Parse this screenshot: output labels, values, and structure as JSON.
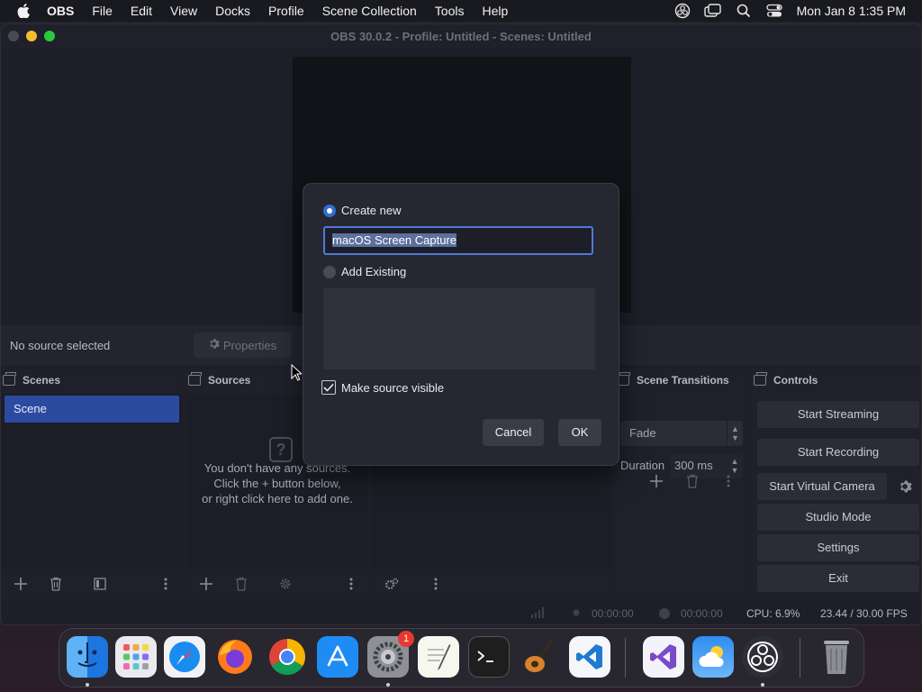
{
  "menubar": {
    "app_name": "OBS",
    "items": [
      "File",
      "Edit",
      "View",
      "Docks",
      "Profile",
      "Scene Collection",
      "Tools",
      "Help"
    ],
    "clock": "Mon Jan 8  1:35 PM"
  },
  "window": {
    "title": "OBS 30.0.2 - Profile: Untitled - Scenes: Untitled"
  },
  "context_bar": {
    "status": "No source selected",
    "properties_label": "Properties"
  },
  "docks": {
    "scenes": {
      "title": "Scenes",
      "items": [
        "Scene"
      ]
    },
    "sources": {
      "title": "Sources",
      "empty_line1": "You don't have any sources.",
      "empty_line2": "Click the + button below,",
      "empty_line3": "or right click here to add one."
    },
    "transitions": {
      "title": "Scene Transitions",
      "selected": "Fade",
      "duration_label": "Duration",
      "duration_value": "300 ms"
    },
    "controls": {
      "title": "Controls",
      "start_streaming": "Start Streaming",
      "start_recording": "Start Recording",
      "start_virtual_camera": "Start Virtual Camera",
      "studio_mode": "Studio Mode",
      "settings": "Settings",
      "exit": "Exit"
    }
  },
  "statusbar": {
    "stream_time": "00:00:00",
    "record_time": "00:00:00",
    "cpu": "CPU: 6.9%",
    "fps": "23.44 / 30.00 FPS"
  },
  "dialog": {
    "create_new_label": "Create new",
    "name_value": "macOS Screen Capture",
    "add_existing_label": "Add Existing",
    "make_visible_label": "Make source visible",
    "make_visible_checked": true,
    "cancel_label": "Cancel",
    "ok_label": "OK"
  },
  "dock": {
    "apps": [
      "finder-icon",
      "launchpad-icon",
      "safari-icon",
      "firefox-icon",
      "chrome-icon",
      "app-store-icon",
      "system-settings-icon",
      "textedit-icon",
      "terminal-icon",
      "garageband-icon",
      "vscode-icon",
      "visual-studio-icon",
      "weather-icon",
      "obs-icon",
      "trash-icon"
    ],
    "settings_badge": "1"
  },
  "colors": {
    "accent": "#2f6fd6",
    "selected_scene": "#2d4aa1",
    "window_bg": "#1e1f28"
  }
}
